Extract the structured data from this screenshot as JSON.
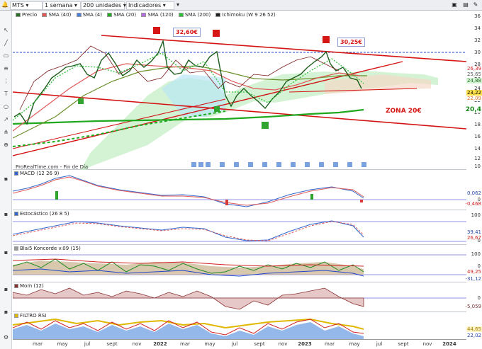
{
  "toolbar": {
    "instrument": "MTS",
    "period": "1 semana",
    "units": "200 unidades",
    "indicators": "Indicadores"
  },
  "price_legend": [
    {
      "label": "Precio",
      "color": "#2b6e2b"
    },
    {
      "label": "SMA (40)",
      "color": "#e05a5a"
    },
    {
      "label": "SMA (4)",
      "color": "#4d7fd6"
    },
    {
      "label": "SMA (20)",
      "color": "#22aa22"
    },
    {
      "label": "SMA (120)",
      "color": "#b06de0"
    },
    {
      "label": "SMA (200)",
      "color": "#2fbf3a"
    },
    {
      "label": "Ichimoku (W 9 26 52)",
      "color": "#222222"
    }
  ],
  "price_axis": [
    "36",
    "34",
    "32",
    "30",
    "28",
    "26",
    "24",
    "22",
    "20",
    "18",
    "16",
    "14",
    "12",
    "10"
  ],
  "price_tags": [
    {
      "text": "26,39",
      "color": "#d02020",
      "bg": "#ffffff"
    },
    {
      "text": "25,65",
      "color": "#555555",
      "bg": "#ffffff"
    },
    {
      "text": "24,88",
      "color": "#1d6e1d",
      "bg": "#d6f5d6"
    },
    {
      "text": "23,22",
      "color": "#000000",
      "bg": "#ffe24a"
    },
    {
      "text": "22,09",
      "color": "#e07020",
      "bg": "#ffffff"
    },
    {
      "text": "20,4",
      "color": "#1a8a1a",
      "bg": "#ffffff"
    }
  ],
  "annotations": {
    "high_2022": "32,60€",
    "high_2023": "30,25€",
    "zone": "ZONA 20€"
  },
  "footer": "ProRealTime.com - Fin de Día",
  "panels": [
    {
      "title": "MACD (12 26 9)",
      "axis": [
        "0"
      ],
      "tags": [
        {
          "text": "0,062",
          "color": "#2244aa"
        },
        {
          "text": "-0,468",
          "color": "#d02020"
        }
      ]
    },
    {
      "title": "Estocástico (26 8 5)",
      "axis": [
        "100",
        "0"
      ],
      "tags": [
        {
          "text": "39,41",
          "color": "#2244aa"
        },
        {
          "text": "26,67",
          "color": "#d02020"
        }
      ]
    },
    {
      "title": "Blai5 Koncorde v.09 (15)",
      "axis": [
        "100",
        "0"
      ],
      "tags": [
        {
          "text": "49,25",
          "color": "#d02020"
        },
        {
          "text": "-31,12",
          "color": "#2244aa"
        }
      ]
    },
    {
      "title": "Mom (12)",
      "axis": [
        "0"
      ],
      "tags": [
        {
          "text": "-5,059",
          "color": "#7a3030"
        }
      ]
    },
    {
      "title": "FILTRO RSI",
      "axis": [],
      "tags": [
        {
          "text": "44,65",
          "color": "#a07a00"
        },
        {
          "text": "22,02",
          "color": "#2244aa"
        }
      ]
    }
  ],
  "x_axis": [
    {
      "label": "mar",
      "year": false
    },
    {
      "label": "may",
      "year": false
    },
    {
      "label": "jul",
      "year": false
    },
    {
      "label": "sept",
      "year": false
    },
    {
      "label": "nov",
      "year": false
    },
    {
      "label": "2022",
      "year": true
    },
    {
      "label": "mar",
      "year": false
    },
    {
      "label": "may",
      "year": false
    },
    {
      "label": "jul",
      "year": false
    },
    {
      "label": "sept",
      "year": false
    },
    {
      "label": "nov",
      "year": false
    },
    {
      "label": "2023",
      "year": true
    },
    {
      "label": "mar",
      "year": false
    },
    {
      "label": "may",
      "year": false
    },
    {
      "label": "jul",
      "year": false
    },
    {
      "label": "sept",
      "year": false
    },
    {
      "label": "nov",
      "year": false
    },
    {
      "label": "2024",
      "year": true
    }
  ]
}
